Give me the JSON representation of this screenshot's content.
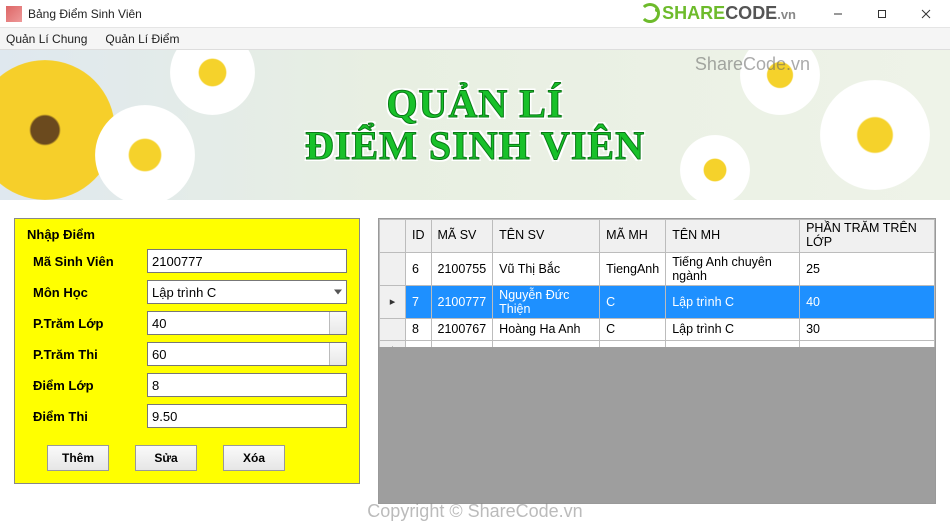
{
  "window": {
    "title": "Bảng Điểm Sinh Viên"
  },
  "menu": {
    "item1": "Quản Lí Chung",
    "item2": "Quản Lí Điểm"
  },
  "banner": {
    "line1": "QUẢN LÍ",
    "line2": "ĐIỂM SINH VIÊN",
    "watermark_share": "ShareCode.vn"
  },
  "brand": {
    "share": "SHARE",
    "code": "CODE",
    "vn": ".vn"
  },
  "form": {
    "title": "Nhập Điểm",
    "labels": {
      "masv": "Mã Sinh Viên",
      "monhoc": "Môn Học",
      "ptramlop": "P.Trăm Lớp",
      "ptramthi": "P.Trăm Thi",
      "diemlop": "Điểm Lớp",
      "diemthi": "Điểm Thi"
    },
    "values": {
      "masv": "2100777",
      "monhoc": "Lập trình C",
      "ptramlop": "40",
      "ptramthi": "60",
      "diemlop": "8",
      "diemthi": "9.50"
    },
    "buttons": {
      "them": "Thêm",
      "sua": "Sửa",
      "xoa": "Xóa"
    }
  },
  "grid": {
    "headers": {
      "id": "ID",
      "masv": "MÃ SV",
      "tensv": "TÊN SV",
      "mamh": "MÃ MH",
      "tenmh": "TÊN MH",
      "phantram": "PHẦN TRĂM TRÊN LỚP"
    },
    "rows": [
      {
        "id": "6",
        "masv": "2100755",
        "tensv": "Vũ Thị Bắc",
        "mamh": "TiengAnh",
        "tenmh": "Tiếng Anh chuyên ngành",
        "pt": "25",
        "selected": false
      },
      {
        "id": "7",
        "masv": "2100777",
        "tensv": "Nguyễn Đức Thiện",
        "mamh": "C",
        "tenmh": "Lập trình C",
        "pt": "40",
        "selected": true
      },
      {
        "id": "8",
        "masv": "2100767",
        "tensv": "Hoàng Ha Anh",
        "mamh": "C",
        "tenmh": "Lập trình C",
        "pt": "30",
        "selected": false
      }
    ]
  },
  "footer": {
    "copyright": "Copyright © ShareCode.vn"
  }
}
